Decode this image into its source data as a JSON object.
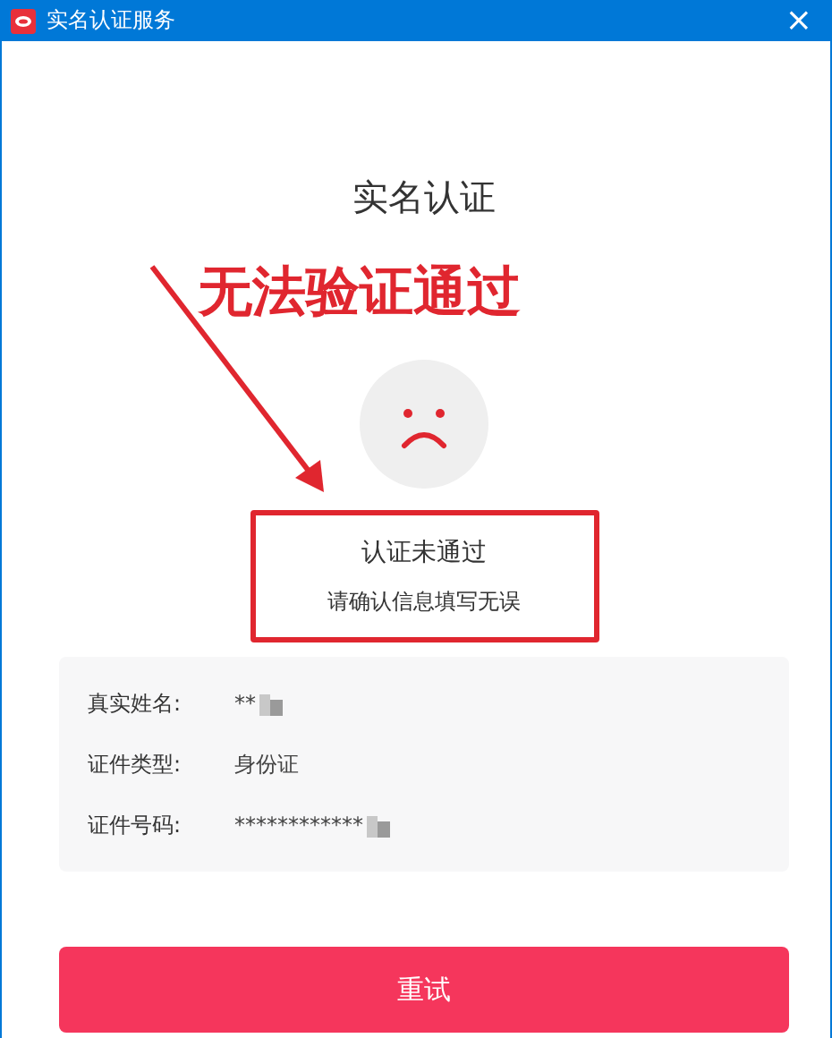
{
  "window": {
    "title": "实名认证服务",
    "close": "×"
  },
  "heading": "实名认证",
  "annotation": {
    "text": "无法验证通过"
  },
  "result": {
    "title": "认证未通过",
    "hint": "请确认信息填写无误"
  },
  "info": [
    {
      "label": "真实姓名:",
      "value": "**",
      "redacted": true
    },
    {
      "label": "证件类型:",
      "value": "身份证",
      "redacted": false
    },
    {
      "label": "证件号码:",
      "value": "************",
      "redacted": true
    }
  ],
  "button": "重试"
}
